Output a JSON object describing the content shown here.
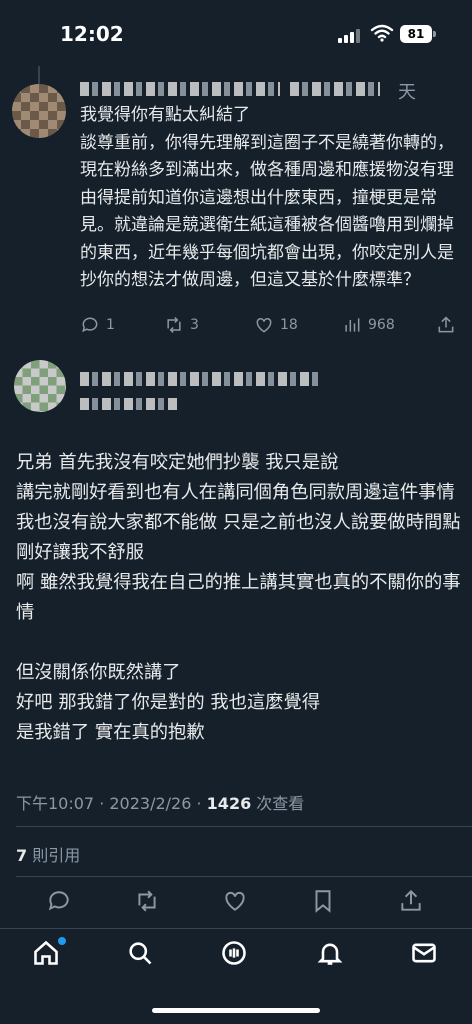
{
  "status_bar": {
    "time": "12:02",
    "battery": "81"
  },
  "reply": {
    "time_label": "天",
    "text": "我覺得你有點太糾結了\n談尊重前，你得先理解到這圈子不是繞著你轉的，現在粉絲多到滿出來，做各種周邊和應援物沒有理由得提前知道你這邊想出什麼東西，撞梗更是常見。就違論是競選衛生紙這種被各個醬嚕用到爛掉的東西，近年幾乎每個坑都會出現，你咬定別人是抄你的想法才做周邊，但這又基於什麼標準？",
    "actions": {
      "reply_count": "1",
      "retweet_count": "3",
      "like_count": "18",
      "view_count": "968"
    }
  },
  "tweet": {
    "text": "兄弟 首先我沒有咬定她們抄襲 我只是說\n講完就剛好看到也有人在講同個角色同款周邊這件事情\n我也沒有說大家都不能做 只是之前也沒人說要做時間點剛好讓我不舒服\n啊 雖然我覺得我在自己的推上講其實也真的不關你的事情\n\n但沒關係你既然講了\n好吧 那我錯了你是對的 我也這麼覺得\n是我錯了 實在真的抱歉",
    "meta": {
      "datetime": "下午10:07 · 2023/2/26 · ",
      "views": "1426",
      "views_label": " 次查看"
    },
    "quotes": {
      "count": "7",
      "label": " 則引用"
    }
  },
  "icons": {
    "reply": "reply-icon",
    "retweet": "retweet-icon",
    "like": "heart-icon",
    "views": "chart-icon",
    "share": "share-icon",
    "bookmark": "bookmark-icon",
    "home": "home-icon",
    "search": "search-icon",
    "spaces": "spaces-icon",
    "notifications": "bell-icon",
    "messages": "mail-icon"
  },
  "colors": {
    "background": "#15202b",
    "accent": "#1d9bf0",
    "muted": "#8b98a5"
  }
}
